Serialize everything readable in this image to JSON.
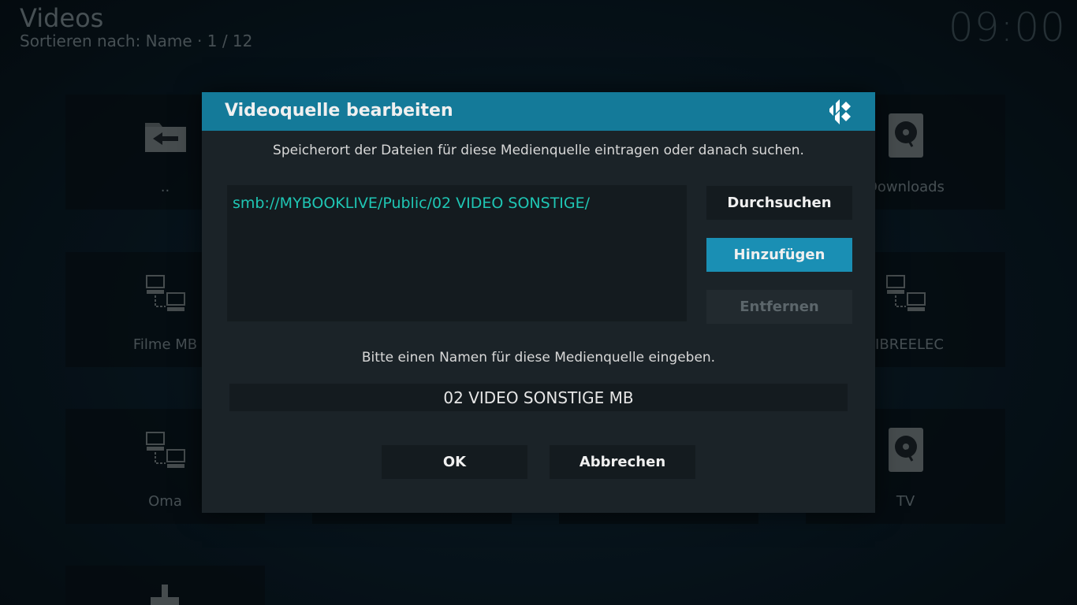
{
  "header": {
    "title": "Videos",
    "subtitle": "Sortieren nach: Name  ·  1 / 12",
    "clock": "09:00"
  },
  "tiles": [
    {
      "label": "..",
      "icon": "folder-back-icon"
    },
    {
      "label": "Downloads",
      "icon": "hard-drive-icon"
    },
    {
      "label": "Filme MB",
      "icon": "network-icon"
    },
    {
      "label": "LIBREELEC",
      "icon": "network-icon"
    },
    {
      "label": "Oma",
      "icon": "network-icon"
    },
    {
      "label": "TV",
      "icon": "hard-drive-icon"
    }
  ],
  "dialog": {
    "title": "Videoquelle bearbeiten",
    "instruction_path": "Speicherort der Dateien für diese Medienquelle eintragen oder danach suchen.",
    "path": "smb://MYBOOKLIVE/Public/02 VIDEO SONSTIGE/",
    "browse_label": "Durchsuchen",
    "add_label": "Hinzufügen",
    "remove_label": "Entfernen",
    "instruction_name": "Bitte einen Namen für diese Medienquelle eingeben.",
    "name_value": "02 VIDEO SONSTIGE MB",
    "ok_label": "OK",
    "cancel_label": "Abbrechen"
  },
  "colors": {
    "header_bar": "#147a99",
    "focused_button": "#1a8fb4",
    "path_text": "#1fc6b4",
    "dialog_bg": "#1b2328"
  }
}
